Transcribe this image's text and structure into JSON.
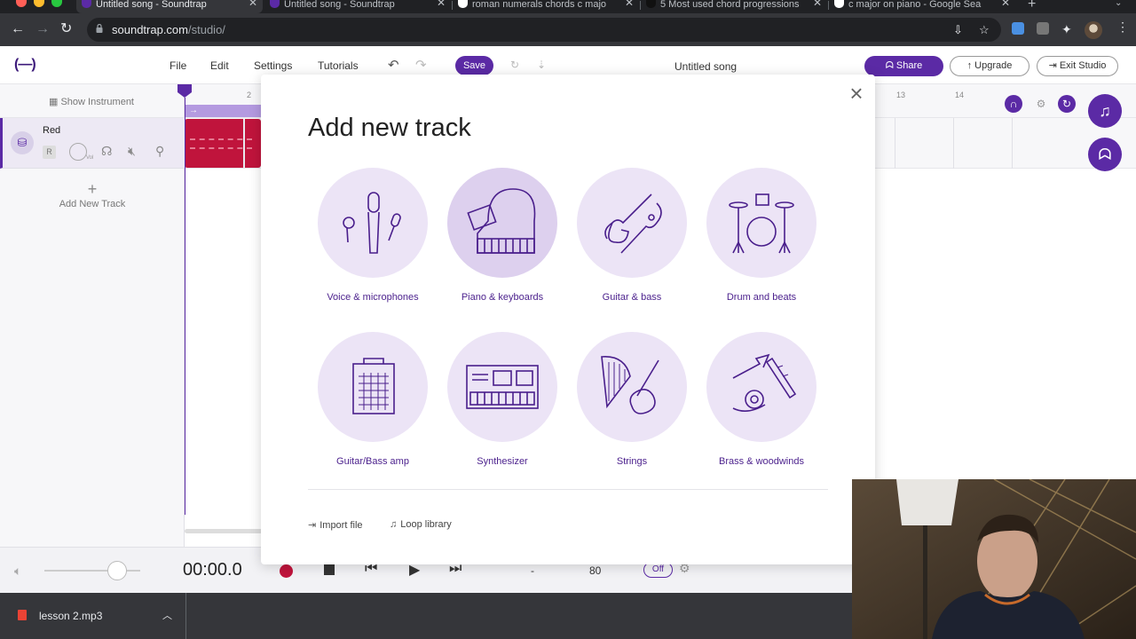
{
  "browser": {
    "tabs": [
      {
        "title": "Untitled song - Soundtrap",
        "active": true,
        "favicon": "soundtrap-icon"
      },
      {
        "title": "Untitled song - Soundtrap",
        "active": false,
        "favicon": "soundtrap-icon"
      },
      {
        "title": "roman numerals chords c majo",
        "active": false,
        "favicon": "google-icon"
      },
      {
        "title": "5 Most used chord progressions",
        "active": false,
        "favicon": "youtube-icon"
      },
      {
        "title": "c major on piano - Google Sea",
        "active": false,
        "favicon": "google-icon"
      }
    ],
    "address": {
      "domain": "soundtrap.com",
      "path": "/studio/"
    }
  },
  "app": {
    "logo": "(—)",
    "menu": [
      "File",
      "Edit",
      "Settings",
      "Tutorials"
    ],
    "save_label": "Save",
    "song_title": "Untitled song",
    "share_label": "Share",
    "upgrade_label": "Upgrade",
    "exit_label": "Exit Studio",
    "show_instrument": "Show Instrument",
    "ruler": [
      "2",
      "13",
      "14"
    ],
    "track": {
      "name": "Red",
      "record": "R",
      "vol_label": "Vol",
      "color": "#c0143c"
    },
    "add_track_label": "Add New Track"
  },
  "transport": {
    "time": "00:00.0",
    "key": "-",
    "tempo": "80",
    "metronome": "Off"
  },
  "modal": {
    "title": "Add new track",
    "instruments": [
      {
        "label": "Voice & microphones",
        "icon": "microphones-icon"
      },
      {
        "label": "Piano & keyboards",
        "icon": "piano-icon"
      },
      {
        "label": "Guitar & bass",
        "icon": "guitar-icon"
      },
      {
        "label": "Drum and beats",
        "icon": "drum-kit-icon"
      },
      {
        "label": "Guitar/Bass amp",
        "icon": "amp-icon"
      },
      {
        "label": "Synthesizer",
        "icon": "synth-icon"
      },
      {
        "label": "Strings",
        "icon": "harp-cello-icon"
      },
      {
        "label": "Brass & woodwinds",
        "icon": "brass-icon"
      }
    ],
    "import_label": "Import file",
    "loop_label": "Loop library"
  },
  "downloads": {
    "file": "lesson 2.mp3"
  },
  "colors": {
    "accent": "#5b2aa5",
    "circle": "#ece4f6",
    "clip": "#c0143c"
  }
}
